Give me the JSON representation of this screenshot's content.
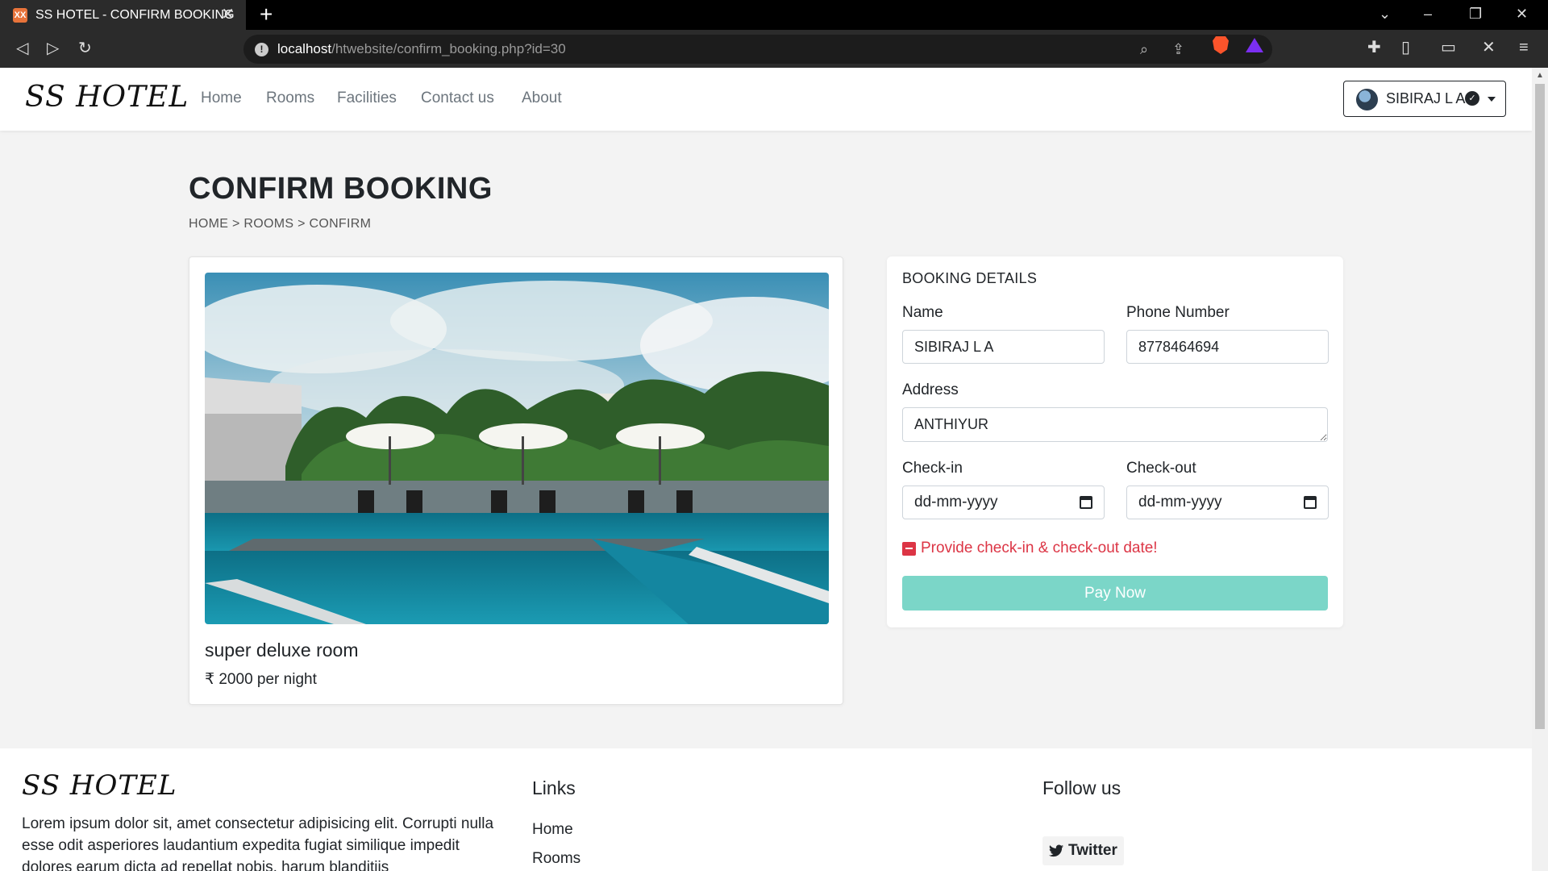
{
  "browser": {
    "tab_title": "SS HOTEL - CONFIRM BOOKING",
    "favicon_text": "XX",
    "url_host": "localhost",
    "url_path": "/htwebsite/confirm_booking.php?id=30"
  },
  "navbar": {
    "brand": "SS HOTEL",
    "links": [
      "Home",
      "Rooms",
      "Facilities",
      "Contact us",
      "About"
    ],
    "user_name": "SIBIRAJ L A"
  },
  "page": {
    "title": "CONFIRM BOOKING",
    "breadcrumb": [
      "HOME",
      "ROOMS",
      "CONFIRM"
    ],
    "breadcrumb_sep": ">"
  },
  "room": {
    "name": "super deluxe room",
    "price": "₹ 2000 per night"
  },
  "booking": {
    "heading": "BOOKING DETAILS",
    "name_label": "Name",
    "name_value": "SIBIRAJ L A",
    "phone_label": "Phone Number",
    "phone_value": "8778464694",
    "address_label": "Address",
    "address_value": "ANTHIYUR",
    "checkin_label": "Check-in",
    "checkout_label": "Check-out",
    "date_placeholder": "dd-mm-yyyy",
    "error_message": "Provide check-in & check-out date!",
    "pay_button": "Pay Now"
  },
  "footer": {
    "brand": "SS HOTEL",
    "description": "Lorem ipsum dolor sit, amet consectetur adipisicing elit. Corrupti nulla esse odit asperiores laudantium expedita fugiat similique impedit dolores earum dicta ad repellat nobis, harum blanditiis",
    "links_heading": "Links",
    "links": [
      "Home",
      "Rooms"
    ],
    "follow_heading": "Follow us",
    "twitter": "Twitter"
  },
  "colors": {
    "accent": "#7bd6c8",
    "error": "#dc3545",
    "background": "#f3f3f3"
  }
}
